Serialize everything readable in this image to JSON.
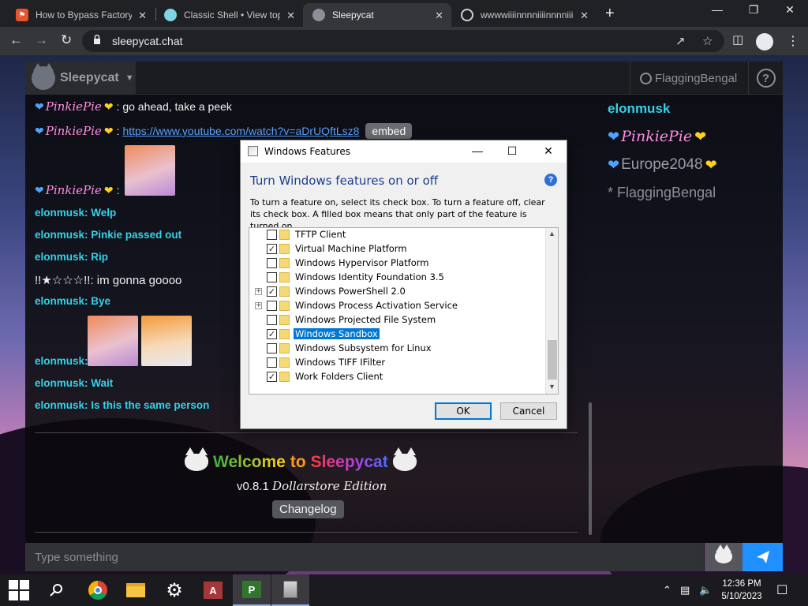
{
  "browser": {
    "tabs": [
      {
        "title": "How to Bypass Factory",
        "favicon": "orange-shield-icon",
        "active": false
      },
      {
        "title": "Classic Shell • View top",
        "favicon": "shell-icon",
        "active": false
      },
      {
        "title": "Sleepycat",
        "favicon": "cat-icon",
        "active": true
      },
      {
        "title": "wwwwiiiinnnniiiinnnniii",
        "favicon": "globe-icon",
        "active": false
      }
    ],
    "url": "sleepycat.chat"
  },
  "app": {
    "name": "Sleepycat",
    "user": "FlaggingBengal",
    "messages": [
      {
        "author": "PinkiePie",
        "text": ": go ahead, take a peek"
      },
      {
        "author": "PinkiePie",
        "link": "https://www.youtube.com/watch?v=aDrUQftLsz8",
        "embed_label": "embed"
      },
      {
        "author": "PinkiePie",
        "text": ":"
      },
      {
        "author": "elonmusk",
        "text": ": Welp"
      },
      {
        "author": "elonmusk",
        "text": ": Pinkie passed out"
      },
      {
        "author": "elonmusk",
        "text": ": Rip"
      },
      {
        "author": "!!★☆☆☆!!",
        "text": ": im gonna goooo"
      },
      {
        "author": "elonmusk",
        "text": ": Bye"
      },
      {
        "author": "elonmusk",
        "text": ":"
      },
      {
        "author": "elonmusk",
        "text": ": Wait"
      },
      {
        "author": "elonmusk",
        "text": ": Is this the same person"
      }
    ],
    "welcome": {
      "word1": "Welcome",
      "word2": "to",
      "word3": "Sleepycat",
      "version": "v0.8.1",
      "edition": "Dollarstore Edition",
      "changelog_label": "Changelog"
    },
    "members": [
      "elonmusk",
      "PinkiePie",
      "Europe2048",
      "* FlaggingBengal"
    ],
    "input_placeholder": "Type something"
  },
  "dialog": {
    "title": "Windows Features",
    "heading": "Turn Windows features on or off",
    "description": "To turn a feature on, select its check box. To turn a feature off, clear its check box. A filled box means that only part of the feature is turned on.",
    "features": [
      {
        "label": "TFTP Client",
        "checked": false,
        "expandable": false
      },
      {
        "label": "Virtual Machine Platform",
        "checked": true,
        "expandable": false
      },
      {
        "label": "Windows Hypervisor Platform",
        "checked": false,
        "expandable": false
      },
      {
        "label": "Windows Identity Foundation 3.5",
        "checked": false,
        "expandable": false
      },
      {
        "label": "Windows PowerShell 2.0",
        "checked": true,
        "expandable": true
      },
      {
        "label": "Windows Process Activation Service",
        "checked": false,
        "expandable": true
      },
      {
        "label": "Windows Projected File System",
        "checked": false,
        "expandable": false
      },
      {
        "label": "Windows Sandbox",
        "checked": true,
        "expandable": false,
        "selected": true
      },
      {
        "label": "Windows Subsystem for Linux",
        "checked": false,
        "expandable": false
      },
      {
        "label": "Windows TIFF IFilter",
        "checked": false,
        "expandable": false
      },
      {
        "label": "Work Folders Client",
        "checked": true,
        "expandable": false
      }
    ],
    "ok_label": "OK",
    "cancel_label": "Cancel"
  },
  "taskbar": {
    "time": "12:36 PM",
    "date": "5/10/2023",
    "apps": [
      "chrome-icon",
      "file-explorer-icon",
      "settings-icon",
      "access-icon",
      "project-icon",
      "windows-features-icon"
    ]
  },
  "colors": {
    "accent_blue": "#1e90ff",
    "elonmusk": "#33d2e6",
    "pinkiepie": "#ff8be0",
    "heart_blue": "#4da3ff",
    "heart_yellow": "#ffd21a"
  }
}
